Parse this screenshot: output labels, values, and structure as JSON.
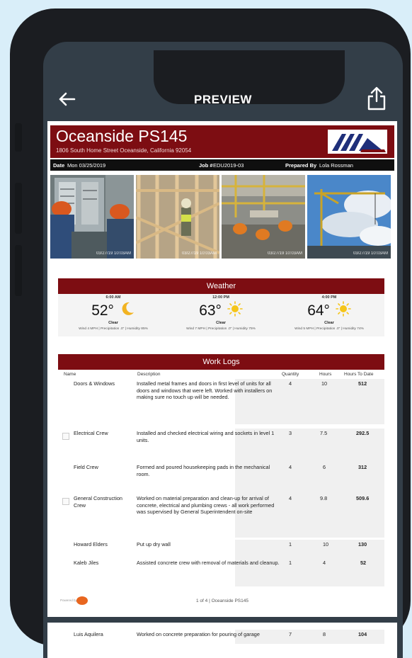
{
  "app": {
    "title": "PREVIEW"
  },
  "report": {
    "project_name": "Oceanside PS145",
    "address": "1806 South Home Street Oceanside, California 92054",
    "date_label": "Date",
    "date_value": "Mon 03/25/2019",
    "job_label": "Job #",
    "job_value": "EDU2019-03",
    "prepared_label": "Prepared By",
    "prepared_value": "Lola Rossman",
    "photos": [
      {
        "stamp": "03/27/19 10:03AM",
        "theme": "electrician"
      },
      {
        "stamp": "03/27/19 10:03AM",
        "theme": "framing"
      },
      {
        "stamp": "03/27/19 10:03AM",
        "theme": "concrete"
      },
      {
        "stamp": "03/27/19 10:03AM",
        "theme": "crane"
      }
    ]
  },
  "weather": {
    "title": "Weather",
    "slots": [
      {
        "time": "6:00 AM",
        "temp": "52°",
        "icon": "moon-icon",
        "condition": "Clear",
        "details": "Wind 4 MPH  |  Precipitation .0\"  |  Humidity 85%"
      },
      {
        "time": "12:00 PM",
        "temp": "63°",
        "icon": "sun-icon",
        "condition": "Clear",
        "details": "Wind 7 MPH  |  Precipitation .0\"  |  Humidity 75%"
      },
      {
        "time": "4:00 PM",
        "temp": "64°",
        "icon": "sun-icon",
        "condition": "Clear",
        "details": "Wind 5 MPH  |  Precipitation .0\"  |  Humidity 74%"
      }
    ]
  },
  "worklogs": {
    "title": "Work Logs",
    "headers": {
      "name": "Name",
      "description": "Description",
      "quantity": "Quantity",
      "hours": "Hours",
      "hours_to_date": "Hours To Date"
    },
    "rows": [
      {
        "name": "Doors & Windows",
        "description": "Installed metal frames and doors in first level of units for all\ndoors and windows that were left. Worked with installers on\nmaking sure no touch up will be needed.",
        "quantity": "4",
        "hours": "10",
        "hours_to_date": "512"
      },
      {
        "name": "Electrical Crew",
        "description": "Installed and checked electrical wiring and sockets in level 1\nunits.",
        "quantity": "3",
        "hours": "7.5",
        "hours_to_date": "292.5"
      },
      {
        "name": "Field Crew",
        "description": "Formed and poured housekeeping pads in the mechanical\nroom.",
        "quantity": "4",
        "hours": "6",
        "hours_to_date": "312"
      },
      {
        "name": "General Construction Crew",
        "description": "Worked on material preparation and clean-up for arrival of\nconcrete, electrical and plumbing crews - all work performed\nwas supervised by General Superintendent on-site",
        "quantity": "4",
        "hours": "9.8",
        "hours_to_date": "509.6"
      },
      {
        "name": "Howard Elders",
        "description": "Put up dry wall",
        "quantity": "1",
        "hours": "10",
        "hours_to_date": "130"
      },
      {
        "name": "Kaleb Jiles",
        "description": "Assisted concrete crew with removal of materials and cleanup.",
        "quantity": "1",
        "hours": "4",
        "hours_to_date": "52"
      }
    ]
  },
  "footer": {
    "page_info": "1 of 4  |  Oceanside PS145",
    "powered_by": "Powered by"
  },
  "next_page": {
    "name": "Luis Aquilera",
    "description": "Worked on concrete preparation for pouring of garage",
    "quantity": "7",
    "hours": "8",
    "hours_to_date": "104"
  },
  "colors": {
    "brand": "#7d0d12",
    "appbar": "#333e48",
    "background": "#d9eef9"
  }
}
